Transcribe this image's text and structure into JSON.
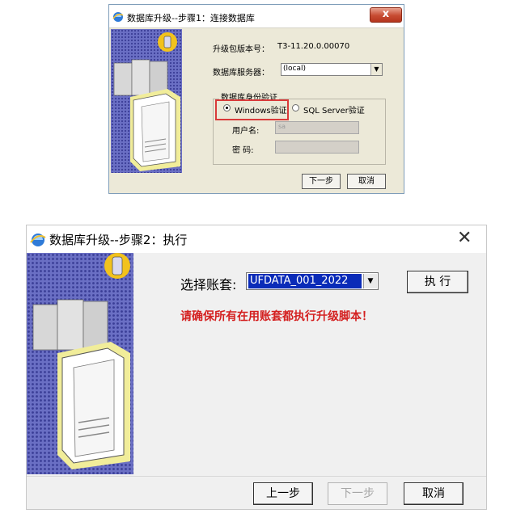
{
  "dialog1": {
    "title": "数据库升级--步骤1：连接数据库",
    "close_label": "x",
    "version_label": "升级包版本号：",
    "version_value": "T3-11.20.0.00070",
    "server_label": "数据库服务器：",
    "server_value": "(local)",
    "auth_group_title": "数据库身份验证",
    "radio_windows": "Windows验证",
    "radio_sql": "SQL Server验证",
    "username_label": "用户名:",
    "username_value": "sa",
    "password_label": "密  码:",
    "next_button": "下一步",
    "cancel_button": "取消",
    "colors": {
      "highlight_box": "#d93a3a",
      "face": "#ece9d8"
    }
  },
  "dialog2": {
    "title": "数据库升级--步骤2：执行",
    "close_label": "✕",
    "select_account_label": "选择账套:",
    "account_value": "UFDATA_001_2022",
    "execute_button": "执 行",
    "warning": "请确保所有在用账套都执行升级脚本！",
    "prev_button": "上一步",
    "next_button": "下一步",
    "cancel_button": "取消",
    "colors": {
      "warning": "#d42020",
      "selection": "#0a2bb8"
    }
  },
  "icons": {
    "app": "ie-like-app-icon",
    "art": "server-tower-illustration",
    "dropdown": "chevron-down-icon"
  }
}
